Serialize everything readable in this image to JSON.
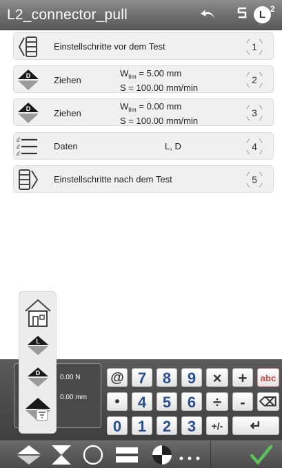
{
  "header": {
    "title": "L2_connector_pull",
    "step_count_icon": "step-count-icon",
    "step_count": "5",
    "load_cell": "L",
    "load_cell_index": "2"
  },
  "steps": [
    {
      "icon": "pre-test-steps-icon",
      "label": "Einstellschritte vor dem Test",
      "number": "1"
    },
    {
      "icon": "pull-down-icon",
      "label": "Ziehen",
      "param1_prefix": "W",
      "param1_sub": "lim",
      "param1_value": " = 5.00 mm",
      "param2": "S = 100.00 mm/min",
      "number": "2"
    },
    {
      "icon": "pull-down-icon",
      "label": "Ziehen",
      "param1_prefix": "W",
      "param1_sub": "lim",
      "param1_value": " = 0.00 mm",
      "param2": "S = 100.00 mm/min",
      "number": "3"
    },
    {
      "icon": "data-list-icon",
      "label": "Daten",
      "center": "L, D",
      "number": "4"
    },
    {
      "icon": "post-test-steps-icon",
      "label": "Einstellschritte nach dem Test",
      "number": "5"
    }
  ],
  "readout": {
    "force": "0.00 N",
    "distance": "0.00 mm"
  },
  "keypad": {
    "row1": [
      "@",
      "7",
      "8",
      "9",
      "×",
      "+",
      "abc"
    ],
    "row2": [
      "•",
      "4",
      "5",
      "6",
      "÷",
      "-",
      "⌫"
    ],
    "row3": [
      "0",
      "1",
      "2",
      "3",
      "+/-",
      "↵"
    ]
  },
  "colors": {
    "header_bg": "#6c6c6c",
    "step_bg": "#f0f0f0",
    "key_text": "#2a4f8f",
    "abc_text": "#c0504d",
    "confirm_green": "#5cc45c"
  }
}
